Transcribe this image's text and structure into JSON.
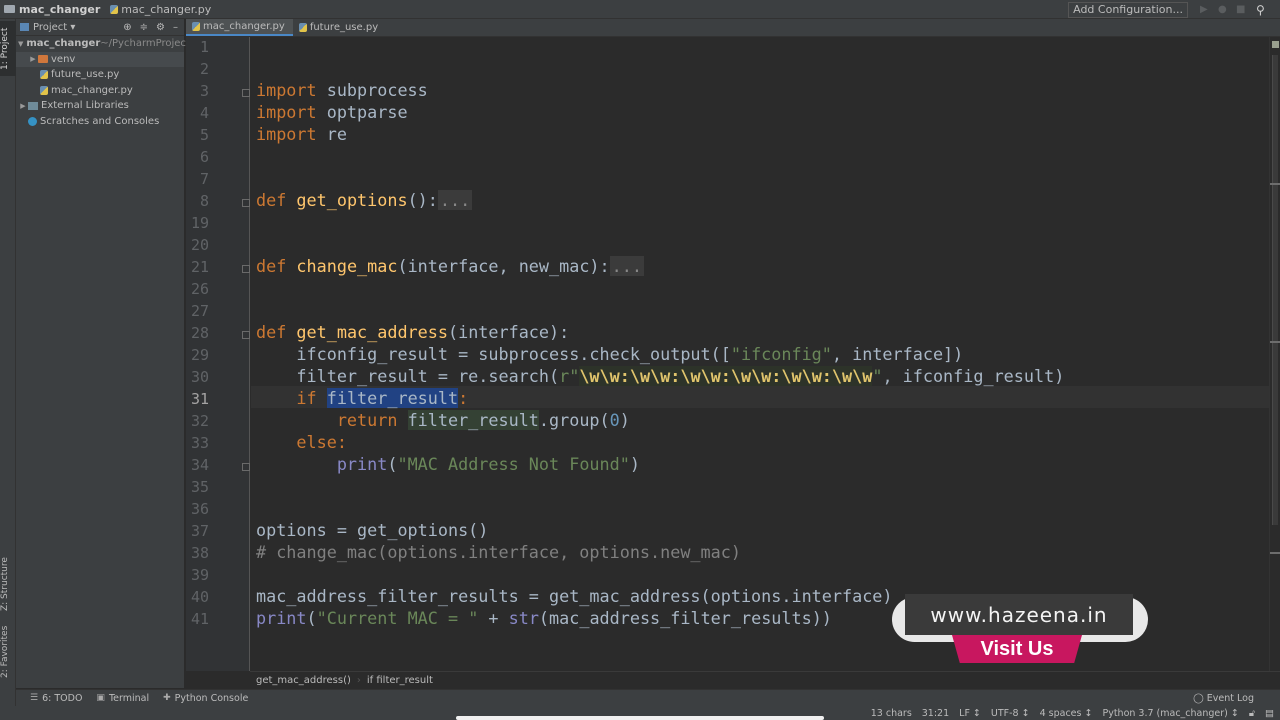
{
  "navbar": {
    "project": "mac_changer",
    "file": "mac_changer.py",
    "add_configuration": "Add Configuration..."
  },
  "left_tool_tabs": [
    "1: Project",
    "Z: Structure",
    "2: Favorites"
  ],
  "project_panel": {
    "title": "Project",
    "tree": [
      {
        "label": "mac_changer",
        "suffix": " ~/PycharmProjec",
        "type": "folder",
        "expanded": true
      },
      {
        "label": "venv",
        "type": "venv",
        "expanded": false
      },
      {
        "label": "future_use.py",
        "type": "py"
      },
      {
        "label": "mac_changer.py",
        "type": "py"
      },
      {
        "label": "External Libraries",
        "type": "lib",
        "expanded": false
      },
      {
        "label": "Scratches and Consoles",
        "type": "scratch"
      }
    ]
  },
  "tabs": [
    {
      "label": "mac_changer.py",
      "active": true
    },
    {
      "label": "future_use.py",
      "active": false
    }
  ],
  "editor": {
    "line_numbers": [
      "1",
      "2",
      "3",
      "4",
      "5",
      "6",
      "7",
      "8",
      "19",
      "20",
      "21",
      "26",
      "27",
      "28",
      "29",
      "30",
      "31",
      "32",
      "33",
      "34",
      "35",
      "36",
      "37",
      "38",
      "39",
      "40",
      "41"
    ],
    "current_line": "31",
    "code": {
      "l3": [
        "import",
        " subprocess"
      ],
      "l4": [
        "import",
        " optparse"
      ],
      "l5": [
        "import",
        " re"
      ],
      "l8": [
        "def",
        " ",
        "get_options",
        "():",
        "..."
      ],
      "l21": [
        "def",
        " ",
        "change_mac",
        "(interface, new_mac):",
        "..."
      ],
      "l28": [
        "def",
        " ",
        "get_mac_address",
        "(interface):"
      ],
      "l29": [
        "    ifconfig_result = subprocess.check_output([",
        "\"ifconfig\"",
        ", interface])"
      ],
      "l30": [
        "    filter_result = re.search(",
        "r\"",
        "\\w\\w:\\w\\w:\\w\\w:\\w\\w:\\w\\w:\\w\\w",
        "\"",
        ", ifconfig_result)"
      ],
      "l31": [
        "    ",
        "if",
        " ",
        "filter_result",
        ":"
      ],
      "l32": [
        "        ",
        "return",
        " ",
        "filter_result",
        ".group(",
        "0",
        ")"
      ],
      "l33": [
        "    ",
        "else",
        ":"
      ],
      "l34": [
        "        ",
        "print",
        "(",
        "\"MAC Address Not Found\"",
        ")"
      ],
      "l37": [
        "options = get_options()"
      ],
      "l38": [
        "# change_mac(options.interface, options.new_mac)"
      ],
      "l40": [
        "mac_address_filter_results = get_mac_address(options.interface)"
      ],
      "l41": [
        "print",
        "(",
        "\"Current MAC = \"",
        " + ",
        "str",
        "(mac_address_filter_results))"
      ]
    }
  },
  "breadcrumb": [
    "get_mac_address()",
    "if filter_result"
  ],
  "bottom_tools": [
    {
      "label": "6: TODO",
      "icon": "todo-icon"
    },
    {
      "label": "Terminal",
      "icon": "terminal-icon"
    },
    {
      "label": "Python Console",
      "icon": "python-icon"
    }
  ],
  "event_log": "Event Log",
  "status": {
    "selection": "13 chars",
    "position": "31:21",
    "line_sep": "LF ↕",
    "encoding": "UTF-8 ↕",
    "indent": "4 spaces ↕",
    "interpreter": "Python 3.7 (mac_changer) ↕"
  },
  "watermark": {
    "url": "www.hazeena.in",
    "cta": "Visit Us",
    "accent": "#c8175f"
  }
}
